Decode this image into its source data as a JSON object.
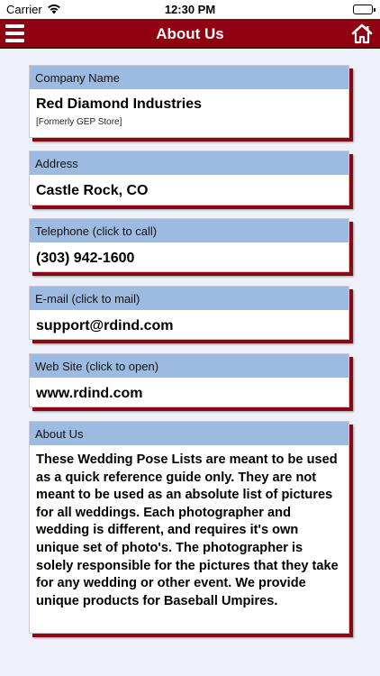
{
  "status_bar": {
    "carrier": "Carrier",
    "time": "12:30 PM"
  },
  "nav": {
    "title": "About Us",
    "menu_icon": "hamburger-menu",
    "home_icon": "home"
  },
  "cards": {
    "company": {
      "label": "Company Name",
      "value": "Red Diamond Industries",
      "note": "[Formerly GEP Store]"
    },
    "address": {
      "label": "Address",
      "value": "Castle Rock, CO"
    },
    "telephone": {
      "label": "Telephone (click to call)",
      "value": "(303) 942-1600"
    },
    "email": {
      "label": "E-mail (click to mail)",
      "value": "support@rdind.com"
    },
    "website": {
      "label": "Web Site (click to open)",
      "value": "www.rdind.com"
    },
    "about": {
      "label": "About Us",
      "text": "These Wedding Pose Lists are meant to be used as a quick reference guide only. They are not meant to be used as an absolute list of pictures for all weddings. Each photographer and wedding is different, and requires it's own unique set of photo's. The photographer is solely responsible for the pictures that they take for any wedding or other event. We provide unique products for Baseball Umpires."
    }
  },
  "colors": {
    "nav": "#900010",
    "card_header": "#9dbbe0",
    "shadow": "#8a0a14",
    "background": "#eef0fa"
  }
}
